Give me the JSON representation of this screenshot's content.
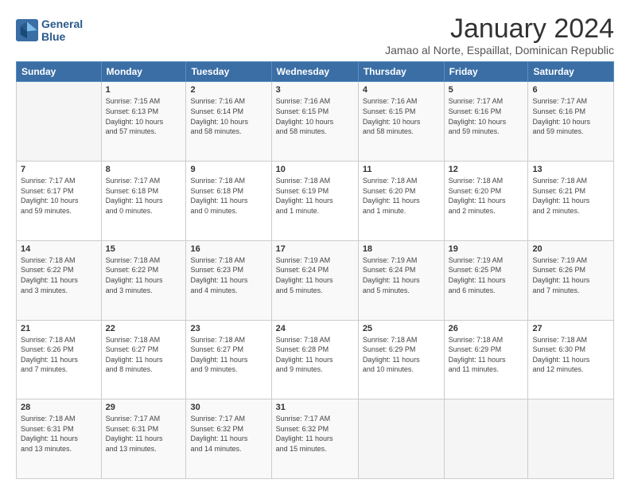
{
  "logo": {
    "line1": "General",
    "line2": "Blue"
  },
  "title": "January 2024",
  "subtitle": "Jamao al Norte, Espaillat, Dominican Republic",
  "header_days": [
    "Sunday",
    "Monday",
    "Tuesday",
    "Wednesday",
    "Thursday",
    "Friday",
    "Saturday"
  ],
  "weeks": [
    [
      {
        "num": "",
        "info": ""
      },
      {
        "num": "1",
        "info": "Sunrise: 7:15 AM\nSunset: 6:13 PM\nDaylight: 10 hours\nand 57 minutes."
      },
      {
        "num": "2",
        "info": "Sunrise: 7:16 AM\nSunset: 6:14 PM\nDaylight: 10 hours\nand 58 minutes."
      },
      {
        "num": "3",
        "info": "Sunrise: 7:16 AM\nSunset: 6:15 PM\nDaylight: 10 hours\nand 58 minutes."
      },
      {
        "num": "4",
        "info": "Sunrise: 7:16 AM\nSunset: 6:15 PM\nDaylight: 10 hours\nand 58 minutes."
      },
      {
        "num": "5",
        "info": "Sunrise: 7:17 AM\nSunset: 6:16 PM\nDaylight: 10 hours\nand 59 minutes."
      },
      {
        "num": "6",
        "info": "Sunrise: 7:17 AM\nSunset: 6:16 PM\nDaylight: 10 hours\nand 59 minutes."
      }
    ],
    [
      {
        "num": "7",
        "info": "Sunrise: 7:17 AM\nSunset: 6:17 PM\nDaylight: 10 hours\nand 59 minutes."
      },
      {
        "num": "8",
        "info": "Sunrise: 7:17 AM\nSunset: 6:18 PM\nDaylight: 11 hours\nand 0 minutes."
      },
      {
        "num": "9",
        "info": "Sunrise: 7:18 AM\nSunset: 6:18 PM\nDaylight: 11 hours\nand 0 minutes."
      },
      {
        "num": "10",
        "info": "Sunrise: 7:18 AM\nSunset: 6:19 PM\nDaylight: 11 hours\nand 1 minute."
      },
      {
        "num": "11",
        "info": "Sunrise: 7:18 AM\nSunset: 6:20 PM\nDaylight: 11 hours\nand 1 minute."
      },
      {
        "num": "12",
        "info": "Sunrise: 7:18 AM\nSunset: 6:20 PM\nDaylight: 11 hours\nand 2 minutes."
      },
      {
        "num": "13",
        "info": "Sunrise: 7:18 AM\nSunset: 6:21 PM\nDaylight: 11 hours\nand 2 minutes."
      }
    ],
    [
      {
        "num": "14",
        "info": "Sunrise: 7:18 AM\nSunset: 6:22 PM\nDaylight: 11 hours\nand 3 minutes."
      },
      {
        "num": "15",
        "info": "Sunrise: 7:18 AM\nSunset: 6:22 PM\nDaylight: 11 hours\nand 3 minutes."
      },
      {
        "num": "16",
        "info": "Sunrise: 7:18 AM\nSunset: 6:23 PM\nDaylight: 11 hours\nand 4 minutes."
      },
      {
        "num": "17",
        "info": "Sunrise: 7:19 AM\nSunset: 6:24 PM\nDaylight: 11 hours\nand 5 minutes."
      },
      {
        "num": "18",
        "info": "Sunrise: 7:19 AM\nSunset: 6:24 PM\nDaylight: 11 hours\nand 5 minutes."
      },
      {
        "num": "19",
        "info": "Sunrise: 7:19 AM\nSunset: 6:25 PM\nDaylight: 11 hours\nand 6 minutes."
      },
      {
        "num": "20",
        "info": "Sunrise: 7:19 AM\nSunset: 6:26 PM\nDaylight: 11 hours\nand 7 minutes."
      }
    ],
    [
      {
        "num": "21",
        "info": "Sunrise: 7:18 AM\nSunset: 6:26 PM\nDaylight: 11 hours\nand 7 minutes."
      },
      {
        "num": "22",
        "info": "Sunrise: 7:18 AM\nSunset: 6:27 PM\nDaylight: 11 hours\nand 8 minutes."
      },
      {
        "num": "23",
        "info": "Sunrise: 7:18 AM\nSunset: 6:27 PM\nDaylight: 11 hours\nand 9 minutes."
      },
      {
        "num": "24",
        "info": "Sunrise: 7:18 AM\nSunset: 6:28 PM\nDaylight: 11 hours\nand 9 minutes."
      },
      {
        "num": "25",
        "info": "Sunrise: 7:18 AM\nSunset: 6:29 PM\nDaylight: 11 hours\nand 10 minutes."
      },
      {
        "num": "26",
        "info": "Sunrise: 7:18 AM\nSunset: 6:29 PM\nDaylight: 11 hours\nand 11 minutes."
      },
      {
        "num": "27",
        "info": "Sunrise: 7:18 AM\nSunset: 6:30 PM\nDaylight: 11 hours\nand 12 minutes."
      }
    ],
    [
      {
        "num": "28",
        "info": "Sunrise: 7:18 AM\nSunset: 6:31 PM\nDaylight: 11 hours\nand 13 minutes."
      },
      {
        "num": "29",
        "info": "Sunrise: 7:17 AM\nSunset: 6:31 PM\nDaylight: 11 hours\nand 13 minutes."
      },
      {
        "num": "30",
        "info": "Sunrise: 7:17 AM\nSunset: 6:32 PM\nDaylight: 11 hours\nand 14 minutes."
      },
      {
        "num": "31",
        "info": "Sunrise: 7:17 AM\nSunset: 6:32 PM\nDaylight: 11 hours\nand 15 minutes."
      },
      {
        "num": "",
        "info": ""
      },
      {
        "num": "",
        "info": ""
      },
      {
        "num": "",
        "info": ""
      }
    ]
  ]
}
